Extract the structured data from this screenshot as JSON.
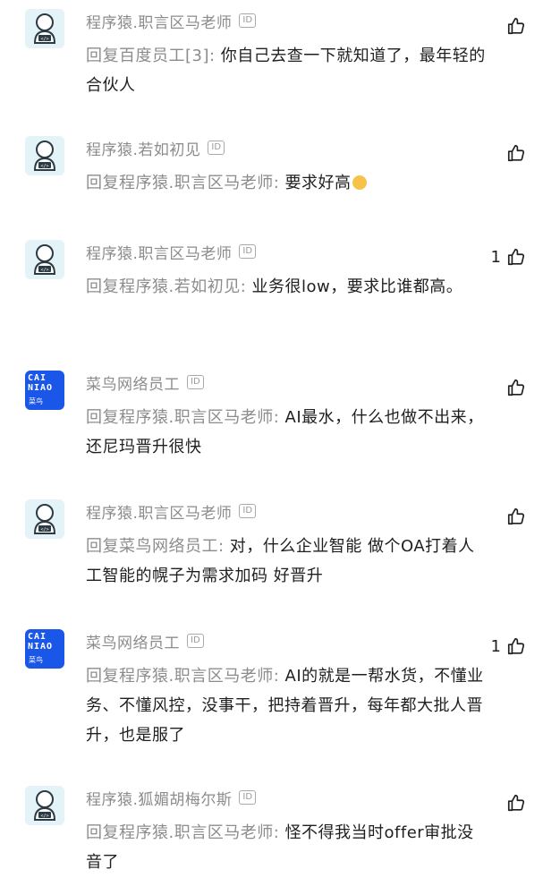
{
  "comments": [
    {
      "avatar": "coder-avatar",
      "name": "程序猿.职言区马老师",
      "id_badge": "ID",
      "reply_prefix": "回复百度员工[3]: ",
      "text": "你自己去查一下就知道了，最年轻的合伙人",
      "likes": ""
    },
    {
      "avatar": "coder-avatar",
      "name": "程序猿.若如初见",
      "id_badge": "ID",
      "reply_prefix": "回复程序猿.职言区马老师: ",
      "text": "要求好高",
      "likes": "",
      "emoji": "face-emoji"
    },
    {
      "avatar": "coder-avatar",
      "name": "程序猿.职言区马老师",
      "id_badge": "ID",
      "reply_prefix": "回复程序猿.若如初见: ",
      "text": "业务很low，要求比谁都高。",
      "likes": "1"
    },
    {
      "avatar": "cainiao-avatar",
      "avatar_text": "CAINIAO",
      "avatar_sub": "菜鸟",
      "name": "菜鸟网络员工",
      "id_badge": "ID",
      "reply_prefix": "回复程序猿.职言区马老师: ",
      "text": "AI最水，什么也做不出来，还尼玛晋升很快",
      "likes": ""
    },
    {
      "avatar": "coder-avatar",
      "name": "程序猿.职言区马老师",
      "id_badge": "ID",
      "reply_prefix": "回复菜鸟网络员工: ",
      "text": "对，什么企业智能 做个OA打着人工智能的幌子为需求加码 好晋升",
      "likes": ""
    },
    {
      "avatar": "cainiao-avatar",
      "avatar_text": "CAINIAO",
      "avatar_sub": "菜鸟",
      "name": "菜鸟网络员工",
      "id_badge": "ID",
      "reply_prefix": "回复程序猿.职言区马老师: ",
      "text": "AI的就是一帮水货，不懂业务、不懂风控，没事干，把持着晋升，每年都大批人晋升，也是服了",
      "likes": "1"
    },
    {
      "avatar": "coder-avatar",
      "name": "程序猿.狐媚胡梅尔斯",
      "id_badge": "ID",
      "reply_prefix": "回复程序猿.职言区马老师: ",
      "text": "怪不得我当时offer审批没音了",
      "likes": ""
    }
  ],
  "colors": {
    "name": "#8c8c8c",
    "text": "#1f1f1f",
    "cainiao_blue": "#1a56e8",
    "coder_bg": "#e3f3f7"
  },
  "icons": {
    "like": "thumbs-up-icon"
  }
}
